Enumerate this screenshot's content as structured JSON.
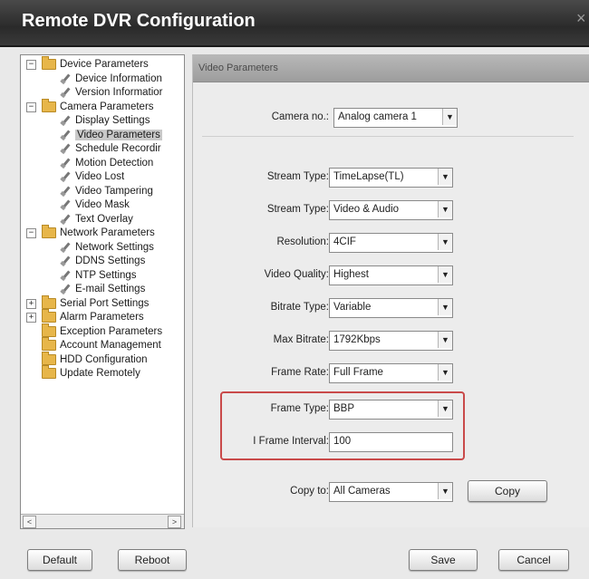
{
  "window": {
    "title": "Remote DVR Configuration",
    "close_glyph": "×"
  },
  "tree": {
    "items": [
      {
        "label": "Device Parameters",
        "type": "folder",
        "expander": "−"
      },
      {
        "label": "Device Information",
        "type": "leaf"
      },
      {
        "label": "Version Informatior",
        "type": "leaf"
      },
      {
        "label": "Camera Parameters",
        "type": "folder",
        "expander": "−"
      },
      {
        "label": "Display Settings",
        "type": "leaf"
      },
      {
        "label": "Video Parameters",
        "type": "leaf",
        "selected": true
      },
      {
        "label": "Schedule Recordir",
        "type": "leaf"
      },
      {
        "label": "Motion Detection",
        "type": "leaf"
      },
      {
        "label": "Video Lost",
        "type": "leaf"
      },
      {
        "label": "Video Tampering",
        "type": "leaf"
      },
      {
        "label": "Video Mask",
        "type": "leaf"
      },
      {
        "label": "Text Overlay",
        "type": "leaf"
      },
      {
        "label": "Network Parameters",
        "type": "folder",
        "expander": "−"
      },
      {
        "label": "Network Settings",
        "type": "leaf"
      },
      {
        "label": "DDNS Settings",
        "type": "leaf"
      },
      {
        "label": "NTP Settings",
        "type": "leaf"
      },
      {
        "label": "E-mail Settings",
        "type": "leaf"
      },
      {
        "label": "Serial Port Settings",
        "type": "folder",
        "expander": "+"
      },
      {
        "label": "Alarm Parameters",
        "type": "folder",
        "expander": "+"
      },
      {
        "label": "Exception Parameters",
        "type": "folder"
      },
      {
        "label": "Account Management",
        "type": "folder"
      },
      {
        "label": "HDD Configuration",
        "type": "folder"
      },
      {
        "label": "Update Remotely",
        "type": "folder"
      }
    ],
    "scroll_left": "<",
    "scroll_right": ">"
  },
  "panel": {
    "header": "Video Parameters",
    "camera_no": {
      "label": "Camera no.:",
      "value": "Analog camera 1"
    },
    "stream_type_1": {
      "label": "Stream Type:",
      "value": "TimeLapse(TL)"
    },
    "stream_type_2": {
      "label": "Stream Type:",
      "value": "Video & Audio"
    },
    "resolution": {
      "label": "Resolution:",
      "value": "4CIF"
    },
    "video_quality": {
      "label": "Video Quality:",
      "value": "Highest"
    },
    "bitrate_type": {
      "label": "Bitrate Type:",
      "value": "Variable"
    },
    "max_bitrate": {
      "label": "Max Bitrate:",
      "value": "1792Kbps"
    },
    "frame_rate": {
      "label": "Frame Rate:",
      "value": "Full Frame"
    },
    "frame_type": {
      "label": "Frame Type:",
      "value": "BBP"
    },
    "i_frame_interval": {
      "label": "I Frame Interval:",
      "value": "100"
    },
    "copy_to": {
      "label": "Copy to:",
      "value": "All Cameras"
    },
    "copy_button": "Copy",
    "dropdown_glyph": "▼"
  },
  "footer": {
    "default": "Default",
    "reboot": "Reboot",
    "save": "Save",
    "cancel": "Cancel"
  },
  "colors": {
    "titlebar": "#2f2f2f",
    "panel_header": "#a8a8a8",
    "highlight_border": "#c94a4a",
    "folder": "#e7b64a"
  }
}
